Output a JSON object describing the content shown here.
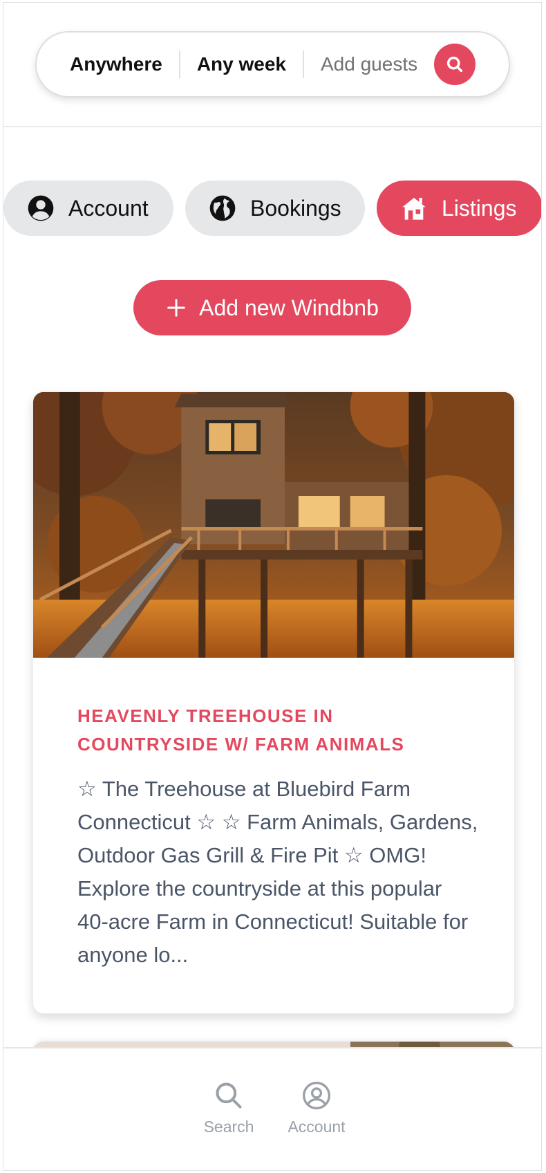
{
  "header": {
    "where": "Anywhere",
    "when": "Any week",
    "guests": "Add guests"
  },
  "tabs": [
    {
      "label": "Account",
      "icon": "user-circle-icon",
      "active": false
    },
    {
      "label": "Bookings",
      "icon": "globe-icon",
      "active": false
    },
    {
      "label": "Listings",
      "icon": "home-icon",
      "active": true
    }
  ],
  "add_button": {
    "label": "Add new Windbnb"
  },
  "listings": [
    {
      "title": "HEAVENLY TREEHOUSE IN COUNTRYSIDE W/ FARM ANIMALS",
      "description": "☆ The Treehouse at Bluebird Farm Connecticut ☆ ☆ Farm Animals, Gardens, Outdoor Gas Grill & Fire Pit ☆ OMG! Explore the countryside at this popular 40-acre Farm in Connecticut! Suitable for anyone lo..."
    }
  ],
  "bottom_nav": {
    "search_label": "Search",
    "account_label": "Account"
  },
  "colors": {
    "accent": "#e4485e",
    "tab_bg": "#e6e7e9",
    "muted": "#9aa0a8"
  }
}
